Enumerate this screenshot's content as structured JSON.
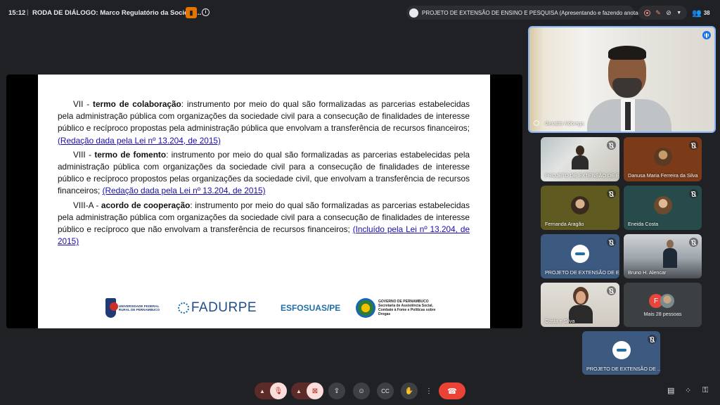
{
  "topbar": {
    "time": "15:12",
    "separator": "|",
    "meeting_title": "RODA DE DIÁLOGO: Marco Regulatório da Socieda...",
    "presenter_label": "PROJETO DE EXTENSÃO DE ENSINO E PESQUISA (Apresentando e fazendo anotações)",
    "participant_count": "38"
  },
  "slide": {
    "p1_prefix": "VII - ",
    "p1_term": "termo de colaboração",
    "p1_body": ": instrumento por meio do qual são formalizadas as parcerias estabelecidas pela administração pública com organizações da sociedade civil para a consecução de finalidades de interesse público e recíproco propostas pela administração pública que envolvam a transferência de recursos financeiros; ",
    "p1_link": "(Redação dada pela Lei nº 13.204, de 2015)",
    "p2_prefix": "VIII - ",
    "p2_term": "termo de fomento",
    "p2_body": ": instrumento por meio do qual são formalizadas as parcerias estabelecidas pela administração pública com organizações da sociedade civil para a consecução de finalidades de interesse público e recíproco propostos pelas organizações da sociedade civil, que envolvam a transferência de recursos financeiros; ",
    "p2_link": "(Redação dada pela Lei nº 13.204, de 2015)",
    "p3_prefix": "VIII-A - ",
    "p3_term": "acordo de cooperação",
    "p3_body": ": instrumento por meio do qual são formalizadas as parcerias estabelecidas pela administração pública com organizações da sociedade civil para a consecução de finalidades de interesse público e recíproco que não envolvam a transferência de recursos financeiros; ",
    "p3_link": "(Incluído pela Lei nº 13.204, de 2015)",
    "logos": {
      "ufrpe": "UNIVERSIDADE FEDERAL RURAL DE PERNAMBUCO",
      "fadurpe": "FADURPE",
      "esfosuas": "ESFOSUAS/PE",
      "gov_title": "GOVERNO DE PERNAMBUCO",
      "gov_body": "Secretaria de Assistência Social, Combate à Fome e Políticas sobre Drogas"
    }
  },
  "participants": {
    "speaker": "Geraldo Nóbrega",
    "tiles": [
      "PROJETO DE EXTENSÃO DE E...",
      "Danusa Maria Ferreira da Silva",
      "Fernanda Aragão",
      "Eneida Costa",
      "PROJETO DE EXTENSÃO DE E...",
      "Bruno H. Alencar",
      "Costa e Silva",
      "Mais 28 pessoas",
      "PROJETO DE EXTENSÃO DE ..."
    ],
    "more_initial": "F"
  },
  "colors": {
    "background": "#202124",
    "accent": "#8ab4f8",
    "hangup": "#ea4335"
  },
  "icons": [
    "info-icon",
    "record-icon",
    "present-icon",
    "emoji-icon",
    "captions-icon",
    "hand-icon",
    "more-icon",
    "chat-icon",
    "activities-icon",
    "lock-icon",
    "mic-off-icon",
    "camera-off-icon",
    "hangup-icon"
  ]
}
